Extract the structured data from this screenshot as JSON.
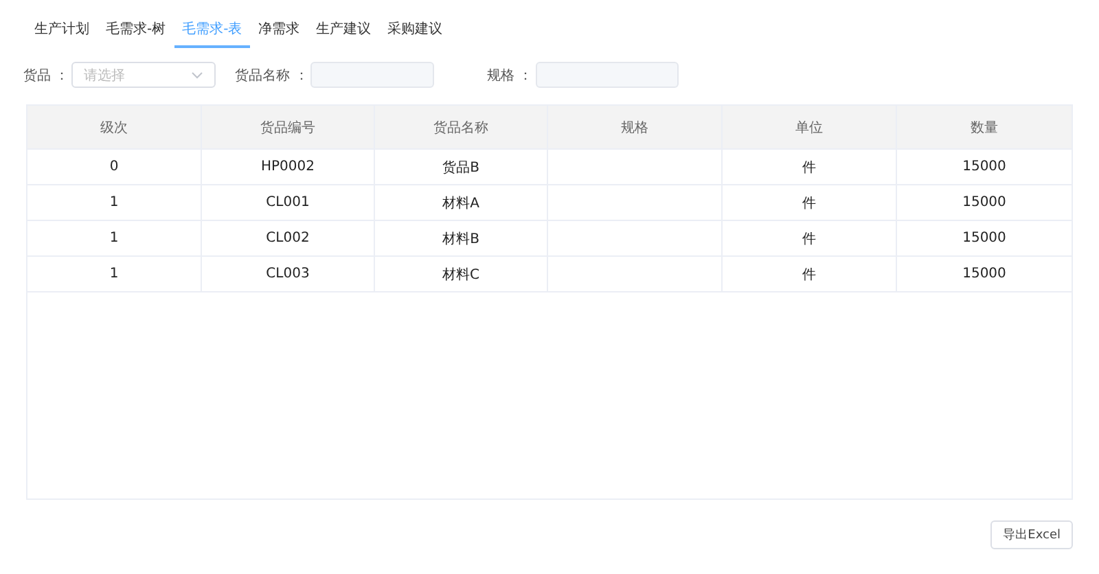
{
  "tabs": [
    {
      "label": "生产计划",
      "selected": false
    },
    {
      "label": "毛需求-树",
      "selected": false
    },
    {
      "label": "毛需求-表",
      "selected": true
    },
    {
      "label": "净需求",
      "selected": false
    },
    {
      "label": "生产建议",
      "selected": false
    },
    {
      "label": "采购建议",
      "selected": false
    }
  ],
  "filters": [
    {
      "kind": "select",
      "label": "货品 ：",
      "placeholder": "请选择"
    },
    {
      "kind": "input",
      "label": "货品名称 ："
    },
    {
      "kind": "input",
      "label": "规格 ："
    }
  ],
  "table": {
    "columns": [
      "级次",
      "货品编号",
      "货品名称",
      "规格",
      "单位",
      "数量"
    ],
    "rows": [
      [
        "0",
        "HP0002",
        "货品B",
        "",
        "件",
        "15000"
      ],
      [
        "1",
        "CL001",
        "材料A",
        "",
        "件",
        "15000"
      ],
      [
        "1",
        "CL002",
        "材料B",
        "",
        "件",
        "15000"
      ],
      [
        "1",
        "CL003",
        "材料C",
        "",
        "件",
        "15000"
      ]
    ]
  },
  "export_button": "导出Excel"
}
